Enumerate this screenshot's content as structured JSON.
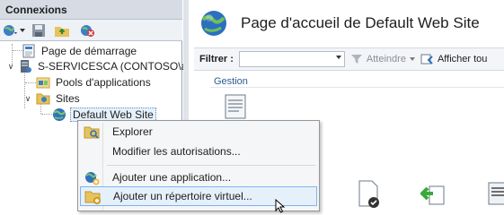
{
  "connections": {
    "title": "Connexions",
    "toolbar": [
      "globe-connect-icon",
      "save-icon",
      "folder-up-icon",
      "disconnect-icon"
    ],
    "tree": [
      {
        "label": "Page de démarrage",
        "icon": "start-page-icon"
      },
      {
        "label": "S-SERVICESCA (CONTOSO\\ad",
        "icon": "server-icon"
      },
      {
        "label": "Pools d'applications",
        "icon": "app-pool-icon"
      },
      {
        "label": "Sites",
        "icon": "sites-folder-icon"
      },
      {
        "label": "Default Web Site",
        "icon": "globe-icon",
        "selected": true
      }
    ]
  },
  "main": {
    "title": "Page d'accueil de Default Web Site",
    "filter": {
      "label": "Filtrer :",
      "value": "",
      "go_label": "Atteindre",
      "show_all_label": "Afficher tou"
    },
    "group_label": "Gestion"
  },
  "context_menu": {
    "items": [
      {
        "label": "Explorer",
        "icon": "explore-icon"
      },
      {
        "label": "Modifier les autorisations...",
        "icon": ""
      },
      {
        "label": "Ajouter une application...",
        "icon": "add-application-icon"
      },
      {
        "label": "Ajouter un répertoire virtuel...",
        "icon": "add-virtual-directory-icon",
        "highlighted": true
      }
    ]
  },
  "colors": {
    "accent": "#2b5d92",
    "selection": "#e5f0fb",
    "selection_border": "#7eb4ea"
  }
}
